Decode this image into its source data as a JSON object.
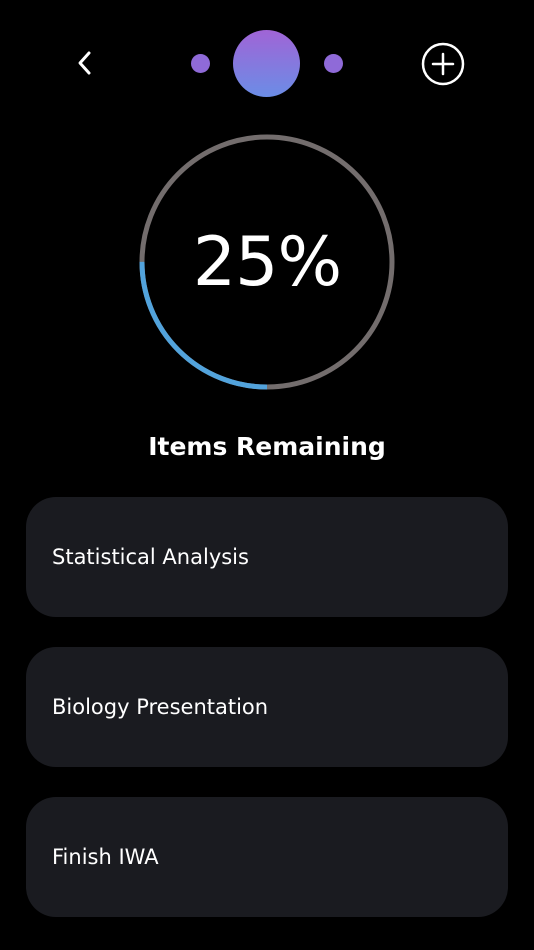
{
  "header": {
    "back_icon": "chevron-left-icon",
    "add_icon": "plus-circle-icon",
    "avatar_gradient": [
      "#a064d6",
      "#6b8de6"
    ],
    "page_dot_color": "#8f6ad8"
  },
  "progress": {
    "label": "25%",
    "value": 0.25,
    "track_color": "#736d6d",
    "fill_color": "#52a3dc"
  },
  "section": {
    "title": "Items Remaining"
  },
  "tasks": [
    {
      "label": "Statistical Analysis"
    },
    {
      "label": "Biology Presentation"
    },
    {
      "label": "Finish IWA"
    }
  ]
}
